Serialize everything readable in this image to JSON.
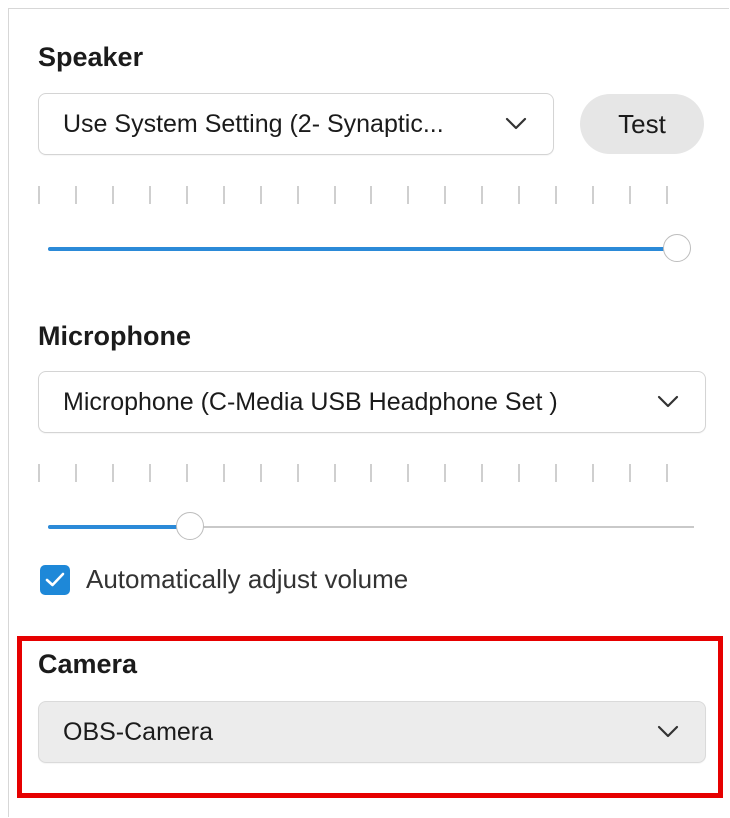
{
  "speaker": {
    "title": "Speaker",
    "device": "Use System Setting (2- Synaptic...",
    "test_label": "Test",
    "volume_fraction": 0.98,
    "tick_count": 18
  },
  "microphone": {
    "title": "Microphone",
    "device": "Microphone (C-Media USB Headphone Set  )",
    "volume_fraction": 0.22,
    "tick_count": 18,
    "auto_adjust_label": "Automatically adjust volume",
    "auto_adjust_checked": true
  },
  "camera": {
    "title": "Camera",
    "device": "OBS-Camera"
  },
  "colors": {
    "accent": "#2b8ad8",
    "checkbox": "#1e88d8",
    "highlight": "#e60000"
  },
  "icons": {
    "dropdown": "chevron-down-icon",
    "checkbox": "checkmark-icon"
  }
}
